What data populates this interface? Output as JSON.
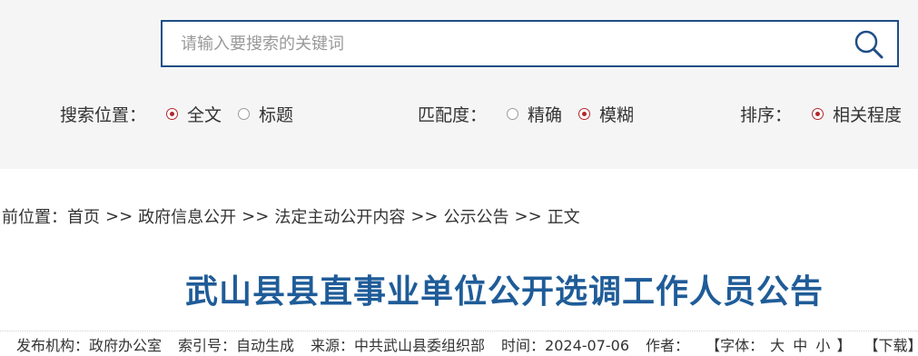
{
  "search": {
    "placeholder": "请输入要搜索的关键词"
  },
  "options": {
    "position": {
      "label": "搜索位置：",
      "items": [
        {
          "label": "全文",
          "checked": true
        },
        {
          "label": "标题",
          "checked": false
        }
      ]
    },
    "match": {
      "label": "匹配度：",
      "items": [
        {
          "label": "精确",
          "checked": false
        },
        {
          "label": "模糊",
          "checked": true
        }
      ]
    },
    "sort": {
      "label": "排序：",
      "items": [
        {
          "label": "相关程度",
          "checked": true
        }
      ]
    }
  },
  "breadcrumb": {
    "label": "当前位置：",
    "sep": ">>",
    "items": [
      "首页",
      "政府信息公开",
      "法定主动公开内容",
      "公示公告",
      "正文"
    ]
  },
  "article": {
    "title": "武山县县直事业单位公开选调工作人员公告",
    "meta": {
      "publisher": "发布机构：政府办公室",
      "index": "索引号：自动生成",
      "source": "来源：中共武山县委组织部",
      "time": "时间：2024-07-06",
      "author": "作者：",
      "font_label": "【字体：",
      "font_large": "大",
      "font_medium": "中",
      "font_small": "小",
      "font_end": "】",
      "download": "【下载】"
    }
  },
  "colors": {
    "accent": "#1f4e86",
    "title": "#1f5c98",
    "radio_checked": "#b0262c",
    "panel_bg": "#f5f5f5"
  },
  "icons": {
    "search": "magnifier"
  }
}
